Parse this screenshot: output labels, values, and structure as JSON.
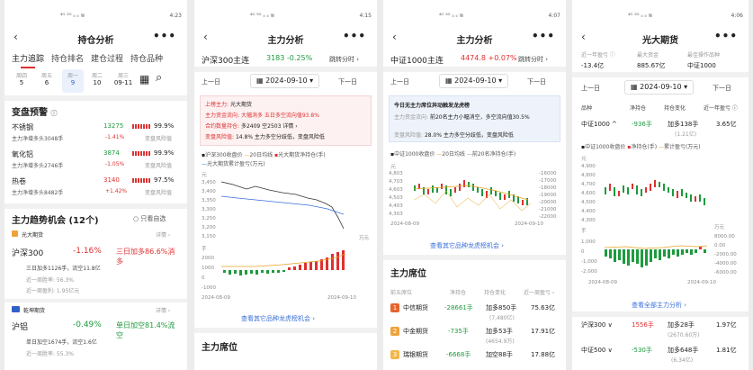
{
  "status": {
    "s1_time": "4:23",
    "s2_time": "4:15",
    "s3_time": "4:07",
    "s4_time": "4:06",
    "signal": "⁴ᴳ ⁵ᴳ ᵢₗ ᵢₗ ≋",
    "battery": "▭ 4"
  },
  "screen1": {
    "title": "持仓分析",
    "tabs": [
      "主力追踪",
      "持仓排名",
      "建仓过程",
      "持仓品种"
    ],
    "dates": [
      {
        "wd": "周四",
        "d": "5"
      },
      {
        "wd": "周五",
        "d": "6"
      },
      {
        "wd": "周一",
        "d": "9"
      },
      {
        "wd": "周二",
        "d": "10"
      },
      {
        "wd": "周三",
        "d": "09-11"
      }
    ],
    "alert_title": "变盘预警",
    "alerts": [
      {
        "name": "不锈钢",
        "price": "13275",
        "pct": "99.9%",
        "sub": "主力净增多头3048手",
        "chg": "-1.41%",
        "note": "变盘风险值"
      },
      {
        "name": "氧化铝",
        "price": "3874",
        "pct": "99.9%",
        "sub": "主力净增多头2746手",
        "chg": "-1.05%",
        "note": "变盘风险值"
      },
      {
        "name": "热卷",
        "price": "3140",
        "pct": "97.5%",
        "sub": "主力净增多头8482手",
        "chg": "+1.42%",
        "note": "变盘风险值"
      }
    ],
    "trend_title": "主力趋势机会 (12个)",
    "self_only": "只看自选",
    "card1": {
      "broker": "光大期货",
      "detail": "详情 ›",
      "name": "沪深300",
      "chg": "-1.16%",
      "tag": "三日加多86.6%消多",
      "l1": "三日加多1126手，流空11.8亿",
      "l2": "近一周胜率: 56.3%",
      "l3": "近一周盈利: 1.95亿元"
    },
    "card2": {
      "broker": "乾坤期货",
      "detail": "详情 ›",
      "name": "沪铝",
      "chg": "-0.49%",
      "tag": "单日加空81.4%流空",
      "l1": "单日加空1674手，流空1.6亿",
      "l2": "近一周胜率: 55.3%"
    }
  },
  "screen2": {
    "title": "主力分析",
    "contract": "沪深300主连",
    "quote": "3183 -0.25%",
    "switch": "跳转分时 ›",
    "prev": "上一日",
    "next": "下一日",
    "date": "2024-09-10",
    "info": [
      {
        "k": "上榜主力:",
        "v": "光大期货"
      },
      {
        "k": "主力资金流向:",
        "v": "大幅消多  五日多空流向值93.8%"
      },
      {
        "k": "合约数量持仓:",
        "v": "多2409  空2503  详情 ›"
      },
      {
        "k": "变盘风险值:",
        "v": "14.8%  主力多空分歧低，变盘风险低"
      }
    ],
    "legend": [
      "沪深300收盘价",
      "20日均线",
      "光大期货净持仓(手)"
    ],
    "legend2": "光大期货累计盈亏(万元)",
    "axis_unit": "元",
    "axis_unit2": "手",
    "axis_unit3": "万元",
    "y_ticks": [
      "3,450",
      "3,400",
      "3,350",
      "3,300",
      "3,250",
      "3,200",
      "3,150"
    ],
    "y2_ticks": [
      "2000",
      "1000",
      "0",
      "-1000"
    ],
    "x_ticks": [
      "2024-08-09",
      "2024-09-10"
    ],
    "link": "查看其它品种龙虎榜机会 ›",
    "bottom_title": "主力席位"
  },
  "screen3": {
    "title": "主力分析",
    "contract": "中证1000主连",
    "quote": "4474.8 +0.07%",
    "switch": "跳转分时 ›",
    "prev": "上一日",
    "next": "下一日",
    "date": "2024-09-10",
    "info_title": "今日无主力席位异动触发龙虎榜",
    "info": [
      {
        "k": "主力资金流向:",
        "v": "前20名主力小幅消空，多空流向值30.5%"
      },
      {
        "k": "变盘风险值:",
        "v": "28.0%  主力多空分歧低，变盘风险低"
      }
    ],
    "legend": [
      "中证1000收盘价",
      "20日均线",
      "前20名净持仓(手)"
    ],
    "axis_unit": "元",
    "y_ticks": [
      "4,803",
      "4,703",
      "4,603",
      "4,503",
      "4,403",
      "4,303"
    ],
    "y_right": [
      "-16000",
      "-17000",
      "-18000",
      "-19000",
      "-20000",
      "-21000",
      "-22000"
    ],
    "x_ticks": [
      "2024-08-09",
      "2024-09-10"
    ],
    "link": "查看其它品种龙虎榜机会 ›",
    "seat_title": "主力席位",
    "cols": [
      "前五席位",
      "净持仓",
      "持仓变化",
      "近一周盈亏 ›"
    ],
    "rows": [
      {
        "rank": "1",
        "name": "中信期货",
        "net": "-28661手",
        "chg": "加多850手",
        "chg2": "(7,480亿)",
        "pl": "75.63亿"
      },
      {
        "rank": "2",
        "name": "中金期货",
        "net": "-735手",
        "chg": "加多53手",
        "chg2": "(4654.9万)",
        "pl": "17.91亿"
      },
      {
        "rank": "3",
        "name": "瑞银期货",
        "net": "-6668手",
        "chg": "加空88手",
        "chg2": "",
        "pl": "17.88亿"
      }
    ]
  },
  "screen4": {
    "title": "光大期货",
    "stats": [
      {
        "k": "近一年盈亏 ⓘ",
        "v": "-13.4亿"
      },
      {
        "k": "最大资金",
        "v": "885.67亿"
      },
      {
        "k": "最佳操作品种",
        "v": "中证1000"
      }
    ],
    "prev": "上一日",
    "next": "下一日",
    "date": "2024-09-10",
    "cols": [
      "品种",
      "净持仓",
      "持仓变化",
      "近一年盈亏 ⓘ"
    ],
    "main_row": {
      "name": "中证1000 ^",
      "net": "-936手",
      "chg": "加多138手",
      "chg2": "(1.21亿)",
      "pl": "3.65亿"
    },
    "legend": [
      "中证1000收盘价",
      "净持仓(手)",
      "累计盈亏(万元)"
    ],
    "axis_unit": "元",
    "axis_unit2": "手",
    "axis_unit3": "万元",
    "y_ticks": [
      "4,900",
      "4,800",
      "4,700",
      "4,600",
      "4,500",
      "4,400",
      "4,300"
    ],
    "y2_ticks": [
      "1,000",
      "0",
      "-1,000",
      "-2,000"
    ],
    "y2_right": [
      "8000.00",
      "0.00",
      "-2000.00",
      "-4000.00",
      "-6000.00"
    ],
    "x_ticks": [
      "2024-08-09",
      "2024-09-10"
    ],
    "link": "查看全部主力分析 ›",
    "rows": [
      {
        "name": "沪深300 ∨",
        "net": "1556手",
        "chg": "加多28手",
        "chg2": "(2670.60万)",
        "pl": "1.97亿"
      },
      {
        "name": "中证500 ∨",
        "net": "-530手",
        "chg": "加多648手",
        "chg2": "(6.34亿)",
        "pl": "1.81亿"
      }
    ]
  }
}
